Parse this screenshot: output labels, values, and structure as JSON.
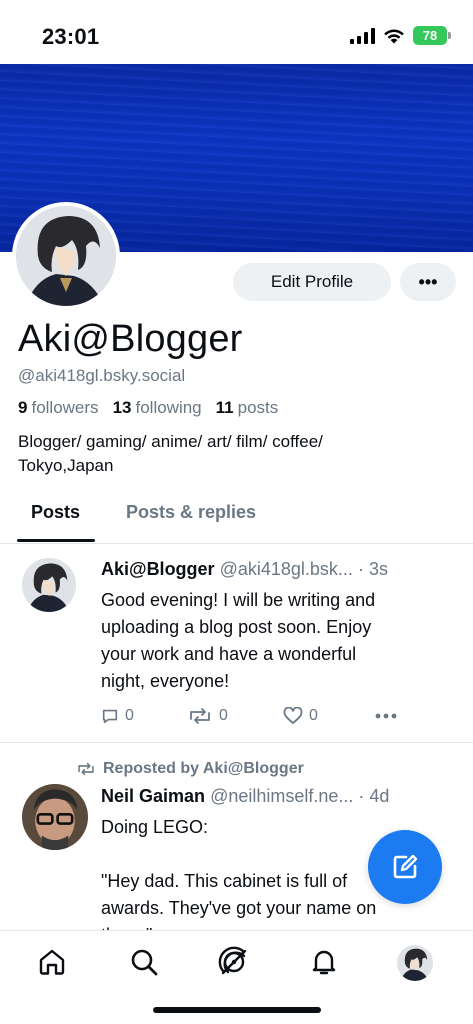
{
  "status_bar": {
    "time": "23:01",
    "battery": "78"
  },
  "profile": {
    "display_name": "Aki@Blogger",
    "handle": "@aki418gl.bsky.social",
    "followers_count": "9",
    "followers_label": "followers",
    "following_count": "13",
    "following_label": "following",
    "posts_count": "11",
    "posts_label": "posts",
    "bio_line1": "Blogger/ gaming/ anime/ art/ film/ coffee/",
    "bio_line2": "Tokyo,Japan",
    "edit_label": "Edit Profile",
    "more_label": "•••"
  },
  "tabs": [
    {
      "label": "Posts"
    },
    {
      "label": "Posts & replies"
    }
  ],
  "feed": [
    {
      "author": "Aki@Blogger",
      "handle": "@aki418gl.bsk...",
      "time": "· 3s",
      "text_lines": [
        "Good evening! I will be writing and",
        "uploading a blog post soon. Enjoy",
        "your work and have a wonderful",
        "night, everyone!"
      ],
      "replies": "0",
      "reposts": "0",
      "likes": "0"
    },
    {
      "repost_label": "Reposted by Aki@Blogger",
      "author": "Neil Gaiman",
      "handle": "@neilhimself.ne...",
      "time": "· 4d",
      "text_lines": [
        "Doing LEGO:",
        "",
        "\"Hey dad. This cabinet is full of",
        "awards. They've got your name on",
        "them.\""
      ]
    }
  ],
  "colors": {
    "banner": "#0b35c4",
    "accent": "#1d7bf2",
    "muted": "#6b7785"
  },
  "icons": {
    "nav": [
      "home-icon",
      "search-icon",
      "feeds-icon",
      "notifications-icon",
      "profile-avatar"
    ],
    "fab": "compose-icon"
  }
}
